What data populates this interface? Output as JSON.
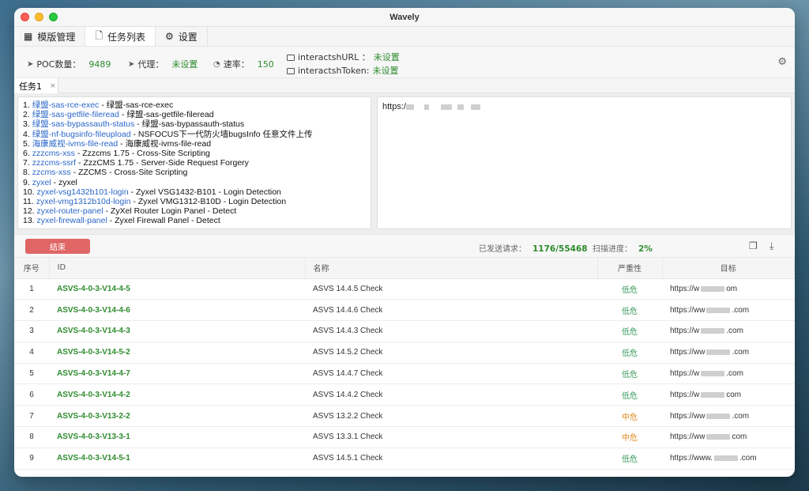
{
  "window": {
    "title": "Wavely"
  },
  "tabs": [
    {
      "label": "模版管理",
      "icon": "grid-icon"
    },
    {
      "label": "任务列表",
      "icon": "document-icon"
    },
    {
      "label": "设置",
      "icon": "settings-icon"
    }
  ],
  "info": {
    "poc_label": "POC数量：",
    "poc_value": "9489",
    "proxy_label": "代理：",
    "proxy_value": "未设置",
    "rate_label": "速率：",
    "rate_value": "150",
    "url_label": "interactshURL ：",
    "url_value": "未设置",
    "token_label": "interactshToken:",
    "token_value": "未设置"
  },
  "task_tab": {
    "label": "任务1",
    "close": "×"
  },
  "poc_list": [
    {
      "n": "1.",
      "id": "绿盟-sas-rce-exec",
      "desc": " - 绿盟-sas-rce-exec"
    },
    {
      "n": "2.",
      "id": "绿盟-sas-getfile-fileread",
      "desc": " - 绿盟-sas-getfile-fileread"
    },
    {
      "n": "3.",
      "id": "绿盟-sas-bypassauth-status",
      "desc": " - 绿盟-sas-bypassauth-status"
    },
    {
      "n": "4.",
      "id": "绿盟-nf-bugsinfo-fileupload",
      "desc": " - NSFOCUS下一代防火墙bugsInfo 任意文件上传"
    },
    {
      "n": "5.",
      "id": "海康威视-ivms-file-read",
      "desc": " - 海康威视-ivms-file-read"
    },
    {
      "n": "6.",
      "id": "zzzcms-xss",
      "desc": " - Zzzcms 1.75 - Cross-Site Scripting"
    },
    {
      "n": "7.",
      "id": "zzzcms-ssrf",
      "desc": " - ZzzCMS 1.75 - Server-Side Request Forgery"
    },
    {
      "n": "8.",
      "id": "zzcms-xss",
      "desc": " - ZZCMS - Cross-Site Scripting"
    },
    {
      "n": "9.",
      "id": "zyxel",
      "desc": " - zyxel"
    },
    {
      "n": "10.",
      "id": "zyxel-vsg1432b101-login",
      "desc": " - Zyxel VSG1432-B101 - Login Detection"
    },
    {
      "n": "11.",
      "id": "zyxel-vmg1312b10d-login",
      "desc": " - Zyxel VMG1312-B10D - Login Detection"
    },
    {
      "n": "12.",
      "id": "zyxel-router-panel",
      "desc": " - ZyXel Router Login Panel - Detect"
    },
    {
      "n": "13.",
      "id": "zyxel-firewall-panel",
      "desc": " - Zyxel Firewall Panel - Detect"
    }
  ],
  "target_text": "https:/",
  "controls": {
    "stop_label": "结束",
    "sent_label": "已发送请求：",
    "sent_value": "1176/55468",
    "progress_label": "扫描进度：",
    "progress_value": "2%"
  },
  "table": {
    "headers": [
      "序号",
      "ID",
      "名称",
      "严重性",
      "目标"
    ],
    "rows": [
      {
        "n": "1",
        "id": "ASVS-4-0-3-V14-4-5",
        "name": "ASVS 14.4.5 Check",
        "sev": "低危",
        "level": "low",
        "tgt_a": "https://w",
        "tgt_b": "om"
      },
      {
        "n": "2",
        "id": "ASVS-4-0-3-V14-4-6",
        "name": "ASVS 14.4.6 Check",
        "sev": "低危",
        "level": "low",
        "tgt_a": "https://ww",
        "tgt_b": ".com"
      },
      {
        "n": "3",
        "id": "ASVS-4-0-3-V14-4-3",
        "name": "ASVS 14.4.3 Check",
        "sev": "低危",
        "level": "low",
        "tgt_a": "https://w",
        "tgt_b": ".com"
      },
      {
        "n": "4",
        "id": "ASVS-4-0-3-V14-5-2",
        "name": "ASVS 14.5.2 Check",
        "sev": "低危",
        "level": "low",
        "tgt_a": "https://ww",
        "tgt_b": ".com"
      },
      {
        "n": "5",
        "id": "ASVS-4-0-3-V14-4-7",
        "name": "ASVS 14.4.7 Check",
        "sev": "低危",
        "level": "low",
        "tgt_a": "https://w",
        "tgt_b": ".com"
      },
      {
        "n": "6",
        "id": "ASVS-4-0-3-V14-4-2",
        "name": "ASVS 14.4.2 Check",
        "sev": "低危",
        "level": "low",
        "tgt_a": "https://w",
        "tgt_b": "com"
      },
      {
        "n": "7",
        "id": "ASVS-4-0-3-V13-2-2",
        "name": "ASVS 13.2.2 Check",
        "sev": "中危",
        "level": "mid",
        "tgt_a": "https://ww",
        "tgt_b": ".com"
      },
      {
        "n": "8",
        "id": "ASVS-4-0-3-V13-3-1",
        "name": "ASVS 13.3.1 Check",
        "sev": "中危",
        "level": "mid",
        "tgt_a": "https://ww",
        "tgt_b": "com"
      },
      {
        "n": "9",
        "id": "ASVS-4-0-3-V14-5-1",
        "name": "ASVS 14.5.1 Check",
        "sev": "低危",
        "level": "low",
        "tgt_a": "https://www.",
        "tgt_b": ".com"
      }
    ]
  }
}
